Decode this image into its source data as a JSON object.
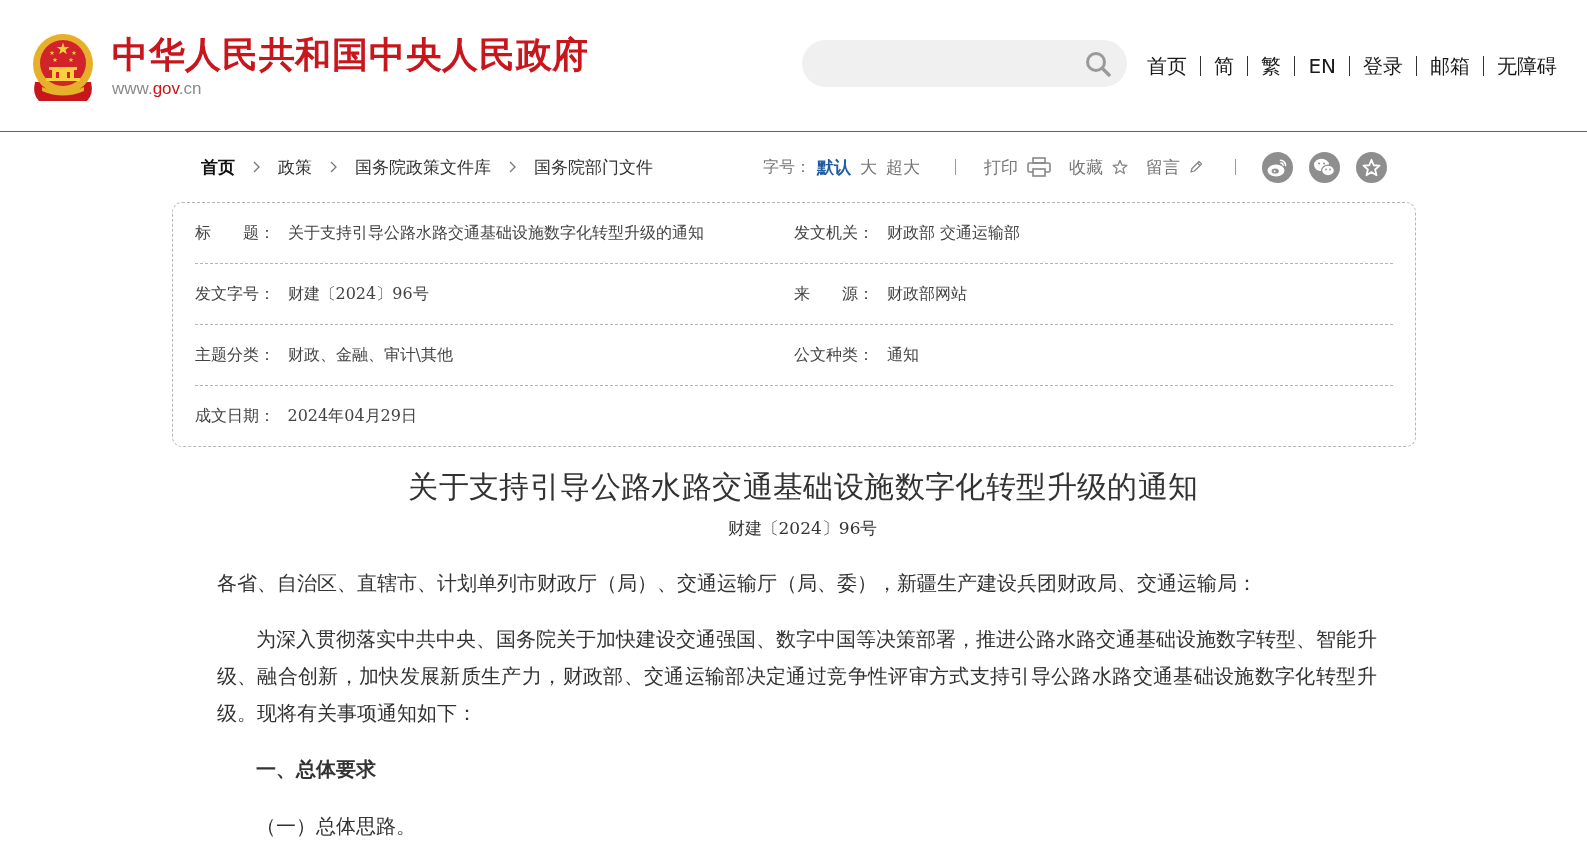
{
  "header": {
    "site_title": "中华人民共和国中央人民政府",
    "site_url": [
      {
        "text": "www.",
        "accent": false
      },
      {
        "text": "gov",
        "accent": true
      },
      {
        "text": ".cn",
        "accent": false
      }
    ],
    "nav_links": [
      "首页",
      "简",
      "繁",
      "EN",
      "登录",
      "邮箱",
      "无障碍"
    ]
  },
  "breadcrumb": [
    "首页",
    "政策",
    "国务院政策文件库",
    "国务院部门文件"
  ],
  "toolbar": {
    "font_size_label": "字号：",
    "font_sizes": [
      {
        "label": "默认",
        "selected": true
      },
      {
        "label": "大",
        "selected": false
      },
      {
        "label": "超大",
        "selected": false
      }
    ],
    "actions": [
      "打印",
      "收藏",
      "留言"
    ]
  },
  "info_table": {
    "rows": [
      [
        {
          "label": "标　　题：",
          "value": "关于支持引导公路水路交通基础设施数字化转型升级的通知"
        },
        {
          "label": "发文机关：",
          "value": "财政部 交通运输部"
        }
      ],
      [
        {
          "label": "发文字号：",
          "value": "财建〔2024〕96号"
        },
        {
          "label": "来　　源：",
          "value": "财政部网站"
        }
      ],
      [
        {
          "label": "主题分类：",
          "value": "财政、金融、审计\\其他"
        },
        {
          "label": "公文种类：",
          "value": "通知"
        }
      ],
      [
        {
          "label": "成文日期：",
          "value": "2024年04月29日"
        }
      ]
    ]
  },
  "document": {
    "title": "关于支持引导公路水路交通基础设施数字化转型升级的通知",
    "doc_number": "财建〔2024〕96号",
    "body": [
      {
        "kind": "salutation",
        "text": "各省、自治区、直辖市、计划单列市财政厅（局）、交通运输厅（局、委），新疆生产建设兵团财政局、交通运输局："
      },
      {
        "kind": "paragraph",
        "text": "为深入贯彻落实中共中央、国务院关于加快建设交通强国、数字中国等决策部署，推进公路水路交通基础设施数字转型、智能升级、融合创新，加快发展新质生产力，财政部、交通运输部决定通过竞争性评审方式支持引导公路水路交通基础设施数字化转型升级。现将有关事项通知如下："
      },
      {
        "kind": "heading",
        "text": "一、总体要求"
      },
      {
        "kind": "paragraph",
        "text": "（一）总体思路。"
      }
    ]
  }
}
